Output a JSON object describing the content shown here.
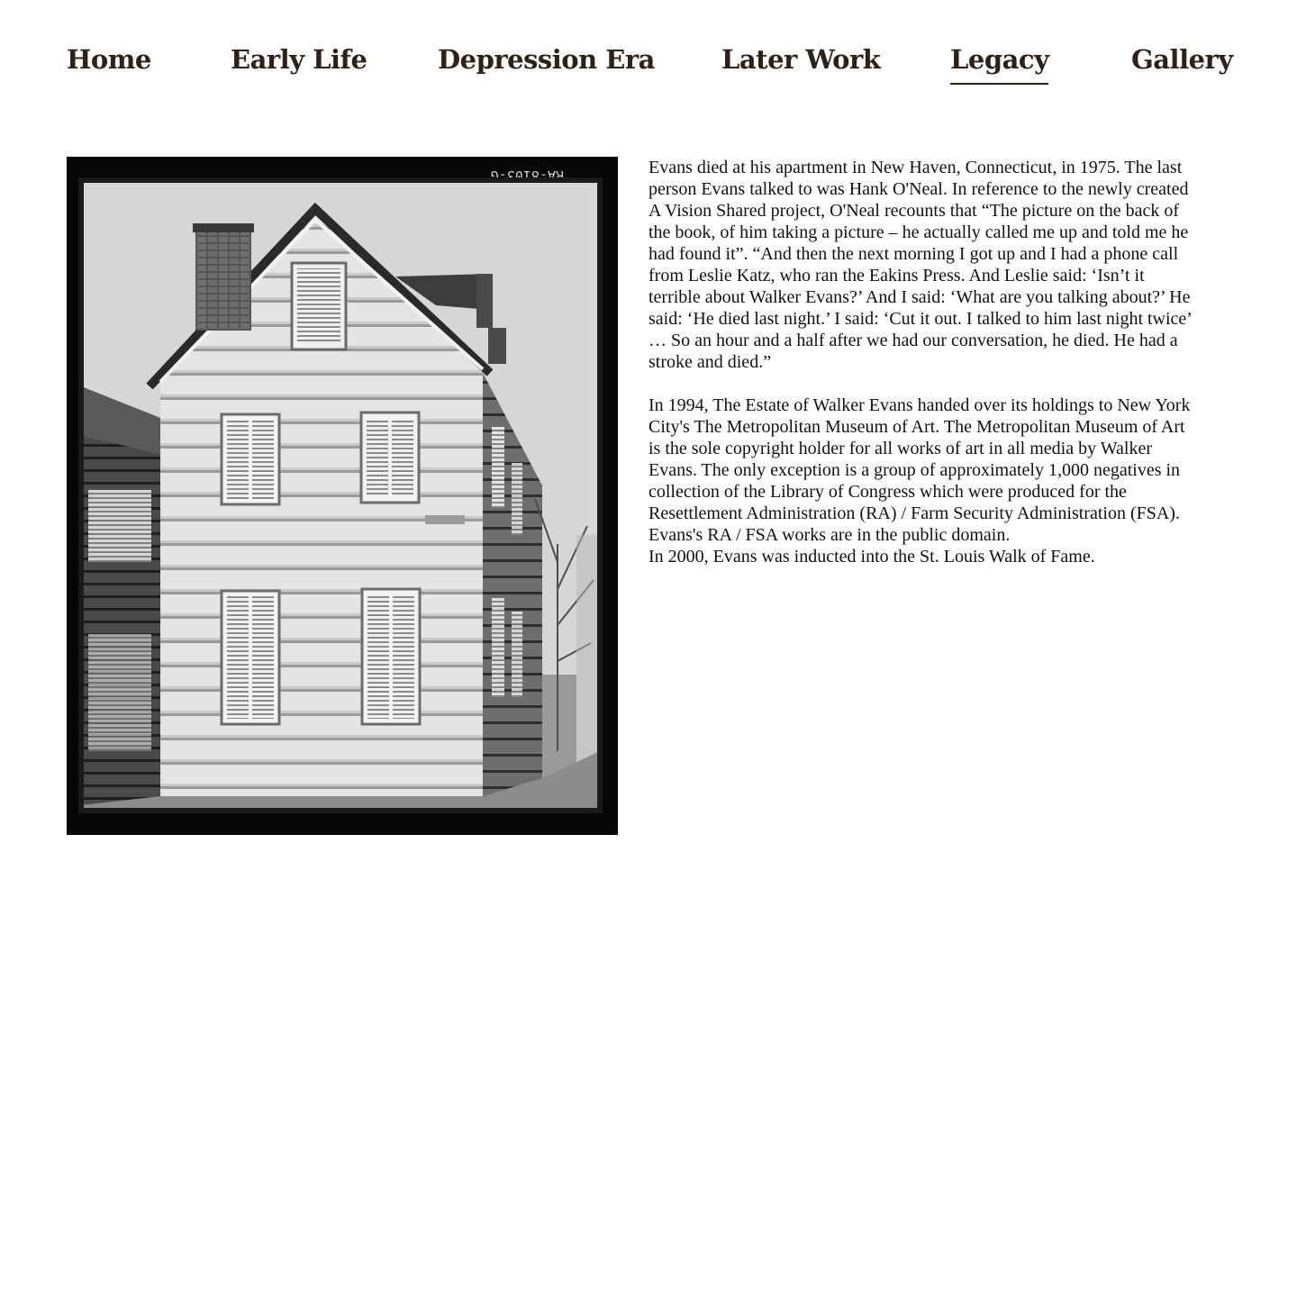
{
  "nav": {
    "items": [
      {
        "label": "Home"
      },
      {
        "label": "Early Life"
      },
      {
        "label": "Depression Era"
      },
      {
        "label": "Later Work"
      },
      {
        "label": "Legacy",
        "active": true
      },
      {
        "label": "Gallery"
      }
    ]
  },
  "photo": {
    "caption_mark": "RA-8103-G",
    "colors": {
      "frame": "#060606",
      "sky": "#d9d9d9",
      "siding": "#e6e6e6",
      "shadow_siding": "#7a7a7a",
      "roof": "#3a3a3a"
    }
  },
  "article": {
    "paragraph_1": "Evans died at his apartment in New Haven, Connecticut, in 1975. The last person Evans talked to was Hank O'Neal. In reference to the newly created A Vision Shared project, O'Neal recounts that “The picture on the back of the book, of him taking a picture – he actually called me up and told me he had found it”. “And then the next morning I got up and I had a phone call from Leslie Katz, who ran the Eakins Press. And Leslie said: ‘Isn’t it terrible about Walker Evans?’ And I said: ‘What are you talking about?’ He said: ‘He died last night.’ I said: ‘Cut it out. I talked to him last night twice’ … So an hour and a half after we had our conversation, he died. He had a stroke and died.”",
    "paragraph_2": "In 1994, The Estate of Walker Evans handed over its holdings to New York City's The Metropolitan Museum of Art. The Metropolitan Museum of Art is the sole copyright holder for all works of art in all media by Walker Evans. The only exception is a group of approximately 1,000 negatives in collection of the Library of Congress which were produced for the Resettlement Administration (RA) / Farm Security Administration (FSA). Evans's RA / FSA works are in the public domain.",
    "paragraph_3": "In 2000, Evans was inducted into the St. Louis Walk of Fame."
  },
  "colors": {
    "nav_text": "#2e2117",
    "body_text": "#111111",
    "background": "#ffffff"
  }
}
